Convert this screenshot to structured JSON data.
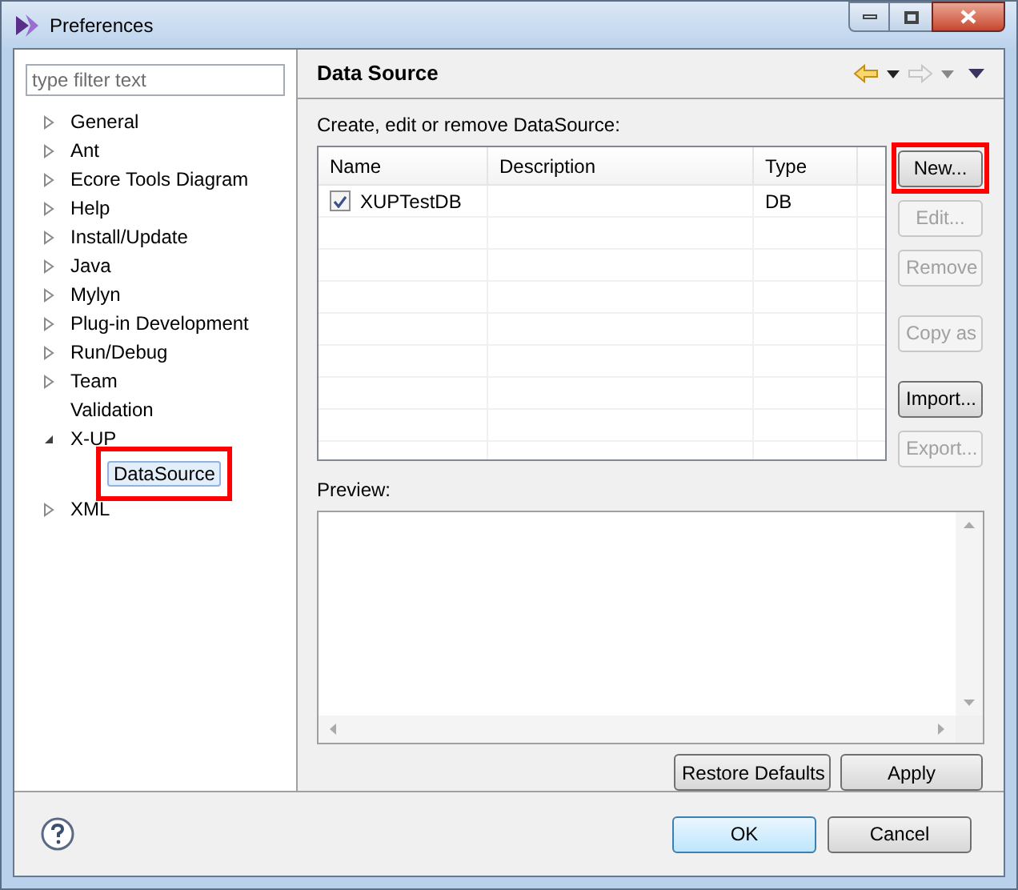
{
  "window": {
    "title": "Preferences"
  },
  "filter": {
    "placeholder": "type filter text"
  },
  "tree": [
    {
      "label": "General",
      "kind": "collapsed",
      "selected": false,
      "highlighted": false
    },
    {
      "label": "Ant",
      "kind": "collapsed",
      "selected": false,
      "highlighted": false
    },
    {
      "label": "Ecore Tools Diagram",
      "kind": "collapsed",
      "selected": false,
      "highlighted": false
    },
    {
      "label": "Help",
      "kind": "collapsed",
      "selected": false,
      "highlighted": false
    },
    {
      "label": "Install/Update",
      "kind": "collapsed",
      "selected": false,
      "highlighted": false
    },
    {
      "label": "Java",
      "kind": "collapsed",
      "selected": false,
      "highlighted": false
    },
    {
      "label": "Mylyn",
      "kind": "collapsed",
      "selected": false,
      "highlighted": false
    },
    {
      "label": "Plug-in Development",
      "kind": "collapsed",
      "selected": false,
      "highlighted": false
    },
    {
      "label": "Run/Debug",
      "kind": "collapsed",
      "selected": false,
      "highlighted": false
    },
    {
      "label": "Team",
      "kind": "collapsed",
      "selected": false,
      "highlighted": false
    },
    {
      "label": "Validation",
      "kind": "leaf",
      "selected": false,
      "highlighted": false
    },
    {
      "label": "X-UP",
      "kind": "expanded",
      "selected": false,
      "highlighted": false,
      "children": [
        {
          "label": "DataSource",
          "kind": "leaf",
          "selected": true,
          "highlighted": true
        }
      ]
    },
    {
      "label": "XML",
      "kind": "collapsed",
      "selected": false,
      "highlighted": false
    }
  ],
  "page": {
    "title": "Data Source",
    "description": "Create, edit or remove DataSource:",
    "table": {
      "columns": [
        "Name",
        "Description",
        "Type"
      ],
      "rows": [
        {
          "cells": [
            "XUPTestDB",
            "",
            "DB"
          ],
          "checked": true
        }
      ]
    },
    "button_groups": [
      [
        {
          "label": "New...",
          "disabled": false,
          "highlighted": true
        },
        {
          "label": "Edit...",
          "disabled": true,
          "highlighted": false
        },
        {
          "label": "Remove",
          "disabled": true,
          "highlighted": false
        }
      ],
      [
        {
          "label": "Copy as",
          "disabled": true,
          "highlighted": false
        }
      ],
      [
        {
          "label": "Import...",
          "disabled": false,
          "highlighted": false
        },
        {
          "label": "Export...",
          "disabled": true,
          "highlighted": false
        }
      ]
    ],
    "preview_label": "Preview:",
    "page_buttons": [
      "Restore Defaults",
      "Apply"
    ]
  },
  "dialog_buttons": [
    {
      "label": "OK",
      "default": true
    },
    {
      "label": "Cancel",
      "default": false
    }
  ]
}
